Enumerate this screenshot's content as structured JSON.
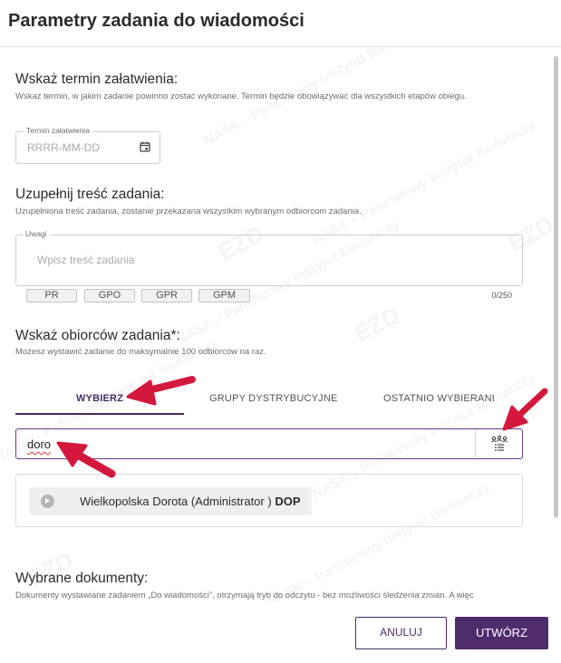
{
  "dialog": {
    "title": "Parametry zadania do wiadomości"
  },
  "deadline": {
    "title": "Wskaż termin załatwienia:",
    "description": "Wskaż termin, w jakim zadanie powinno zostać wykonane. Termin będzie obowiązywać dla wszystkich etapów obiegu.",
    "field_label": "Termin załatwienia",
    "placeholder": "RRRR-MM-DD"
  },
  "content": {
    "title": "Uzupełnij treść zadania:",
    "description": "Uzupełniona treść zadania, zostanie przekazana wszystkim wybranym odbiorcom zadania.",
    "field_label": "Uwagi",
    "placeholder": "Wpisz treść zadania",
    "chips": [
      "PR",
      "GPO",
      "GPR",
      "GPM"
    ],
    "counter": "0/250"
  },
  "recipients": {
    "title": "Wskaż obiorców zadania*:",
    "description": "Możesz wystawić zadanie do maksymalnie 100 odbiorców na raz.",
    "tabs": [
      "WYBIERZ",
      "GRUPY DYSTRYBUCYJNE",
      "OSTATNIO WYBIERANI"
    ],
    "search_value": "doro",
    "result": {
      "name": "Wielkopolska Dorota (Administrator )",
      "code": "DOP"
    }
  },
  "documents": {
    "title": "Wybrane dokumenty:",
    "description": "Dokumenty wystawiane zadaniem „Do wiadomości”, otrzymają tryb do odczytu - bez możliwości śledzenia zmian. A więc"
  },
  "footer": {
    "cancel_label": "ANULUJ",
    "create_label": "UTWÓRZ"
  },
  "watermark": {
    "text": "NASK – Państwowy Instytut Badawczy",
    "logo": "EZD"
  },
  "colors": {
    "accent": "#4f2c6b",
    "annotation_arrow": "#d4183d"
  }
}
